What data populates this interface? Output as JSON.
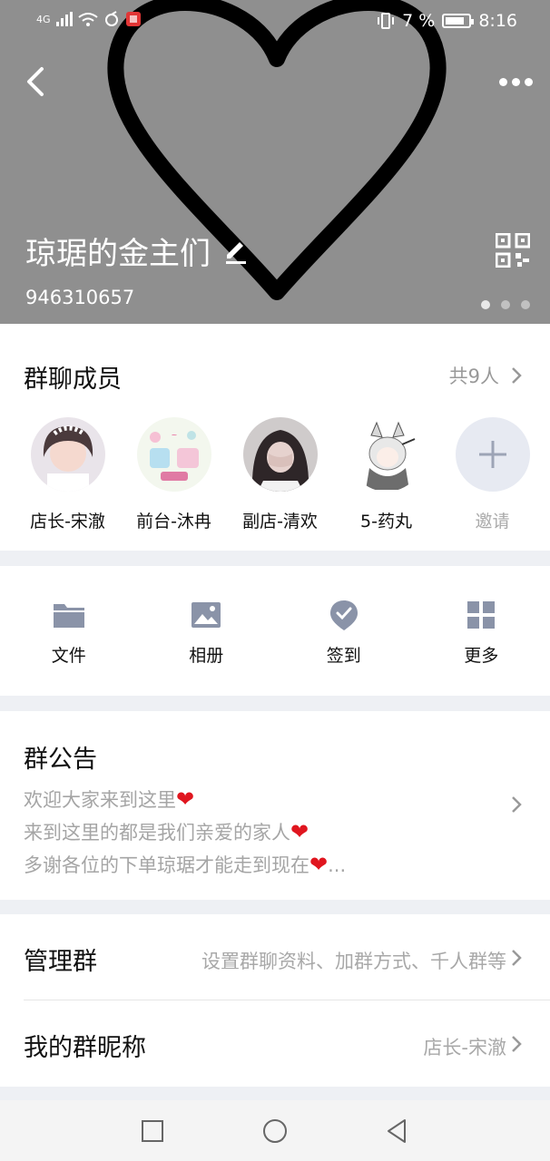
{
  "status_bar": {
    "network": "4G",
    "battery": "7 %",
    "time": "8:16"
  },
  "header": {
    "group_name": "琼琚的金主们",
    "group_id": "946310657"
  },
  "members": {
    "title": "群聊成员",
    "count": "共9人",
    "list": [
      {
        "name": "店长-宋澈"
      },
      {
        "name": "前台-沐冉"
      },
      {
        "name": "副店-清欢"
      },
      {
        "name": "5-药丸"
      }
    ],
    "invite_label": "邀请"
  },
  "actions": [
    {
      "label": "文件",
      "icon": "folder-icon"
    },
    {
      "label": "相册",
      "icon": "image-icon"
    },
    {
      "label": "签到",
      "icon": "checkin-icon"
    },
    {
      "label": "更多",
      "icon": "grid-icon"
    }
  ],
  "notice": {
    "title": "群公告",
    "lines": [
      "欢迎大家来到这里",
      "来到这里的都是我们亲爱的家人",
      "多谢各位的下单琼琚才能走到现在"
    ],
    "heart": "❤",
    "ellipsis": "..."
  },
  "manage": {
    "label": "管理群",
    "value": "设置群聊资料、加群方式、千人群等"
  },
  "nickname": {
    "label": "我的群昵称",
    "value": "店长-宋澈"
  },
  "colors": {
    "header_bg": "#8f8f8f",
    "icon_gray": "#8a93a8",
    "heart_red": "#e0161f"
  }
}
